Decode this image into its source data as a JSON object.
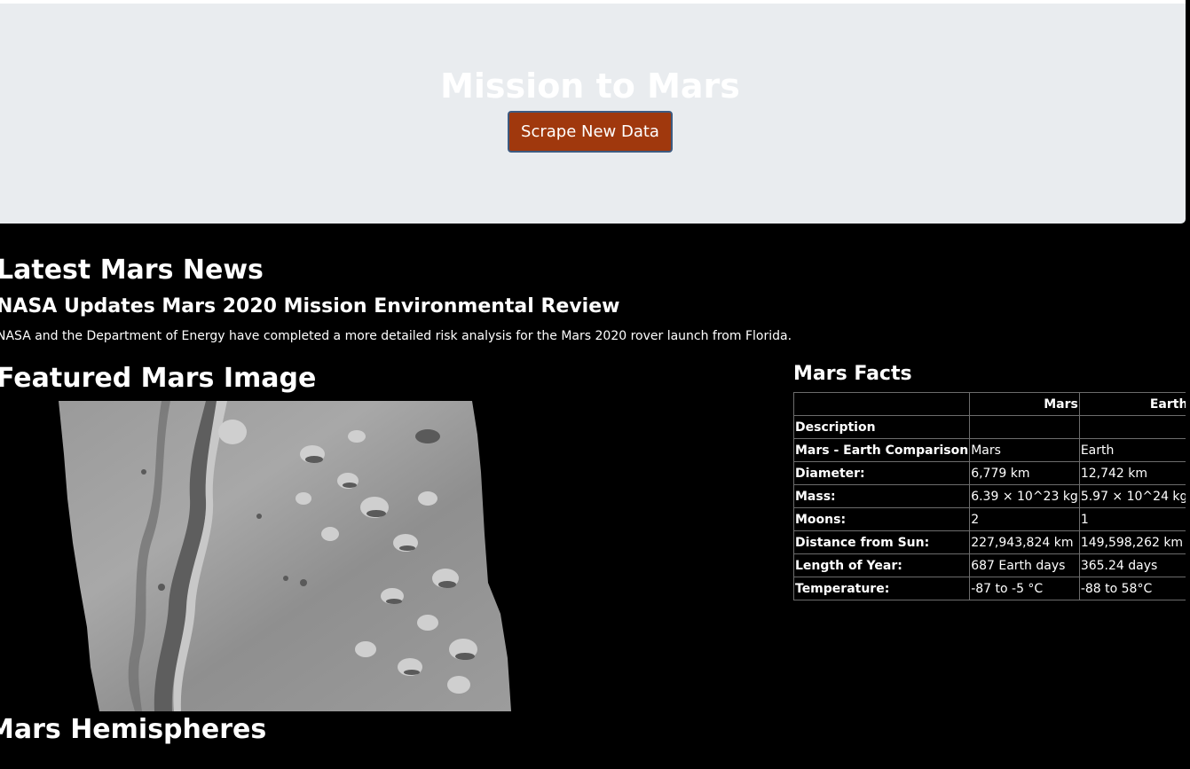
{
  "jumbotron": {
    "title": "Mission to Mars",
    "button_label": "Scrape New Data"
  },
  "news": {
    "heading": "Latest Mars News",
    "title": "NASA Updates Mars 2020 Mission Environmental Review",
    "paragraph": "NASA and the Department of Energy have completed a more detailed risk analysis for the Mars 2020 rover launch from Florida."
  },
  "featured": {
    "heading": "Featured Mars Image"
  },
  "facts": {
    "heading": "Mars Facts",
    "columns": [
      "",
      "Mars",
      "Earth"
    ],
    "rows": [
      {
        "label": "Description",
        "mars": "",
        "earth": ""
      },
      {
        "label": "Mars - Earth Comparison",
        "mars": "Mars",
        "earth": "Earth"
      },
      {
        "label": "Diameter:",
        "mars": "6,779 km",
        "earth": "12,742 km"
      },
      {
        "label": "Mass:",
        "mars": "6.39 × 10^23 kg",
        "earth": "5.97 × 10^24 kg"
      },
      {
        "label": "Moons:",
        "mars": "2",
        "earth": "1"
      },
      {
        "label": "Distance from Sun:",
        "mars": "227,943,824 km",
        "earth": "149,598,262 km"
      },
      {
        "label": "Length of Year:",
        "mars": "687 Earth days",
        "earth": "365.24 days"
      },
      {
        "label": "Temperature:",
        "mars": "-87 to -5 °C",
        "earth": "-88 to 58°C"
      }
    ]
  },
  "hemispheres": {
    "heading": "Mars Hemispheres"
  },
  "colors": {
    "page_bg": "#000000",
    "jumbotron_bg": "#e9ecef",
    "button_bg": "#a0380d",
    "button_border": "#3d5a80"
  }
}
